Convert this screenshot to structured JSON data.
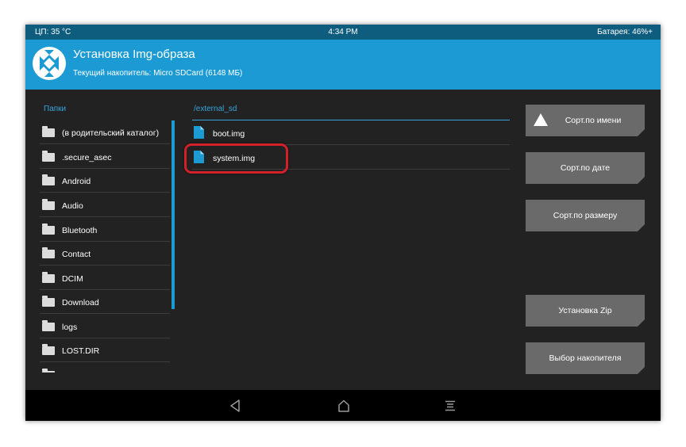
{
  "status": {
    "cpu": "ЦП: 35 °C",
    "time": "4:34 PM",
    "battery": "Батарея: 46%+"
  },
  "header": {
    "title": "Установка Img-образа",
    "subtitle": "Текущий накопитель: Micro SDCard (6148 МБ)"
  },
  "folders": {
    "title": "Папки",
    "items": [
      "(в родительский каталог)",
      ".secure_asec",
      "Android",
      "Audio",
      "Bluetooth",
      "Contact",
      "DCIM",
      "Download",
      "logs",
      "LOST.DIR"
    ]
  },
  "files": {
    "path": "/external_sd",
    "items": [
      "boot.img",
      "system.img"
    ],
    "highlighted": "system.img"
  },
  "buttons": {
    "sort_name": "Сорт.по имени",
    "sort_date": "Сорт.по дате",
    "sort_size": "Сорт.по размеру",
    "install_zip": "Установка Zip",
    "select_storage": "Выбор накопителя"
  },
  "colors": {
    "accent": "#1b9ad4",
    "status_bar": "#0f5d7e",
    "background": "#222222",
    "button": "#6a6a6a",
    "highlight": "#d0202a"
  },
  "icons": {
    "logo": "twrp-logo-icon",
    "folder": "folder-icon",
    "file": "file-icon",
    "back": "back-icon",
    "home": "home-icon",
    "menu": "menu-icon",
    "sort": "sort-triangle-icon"
  }
}
